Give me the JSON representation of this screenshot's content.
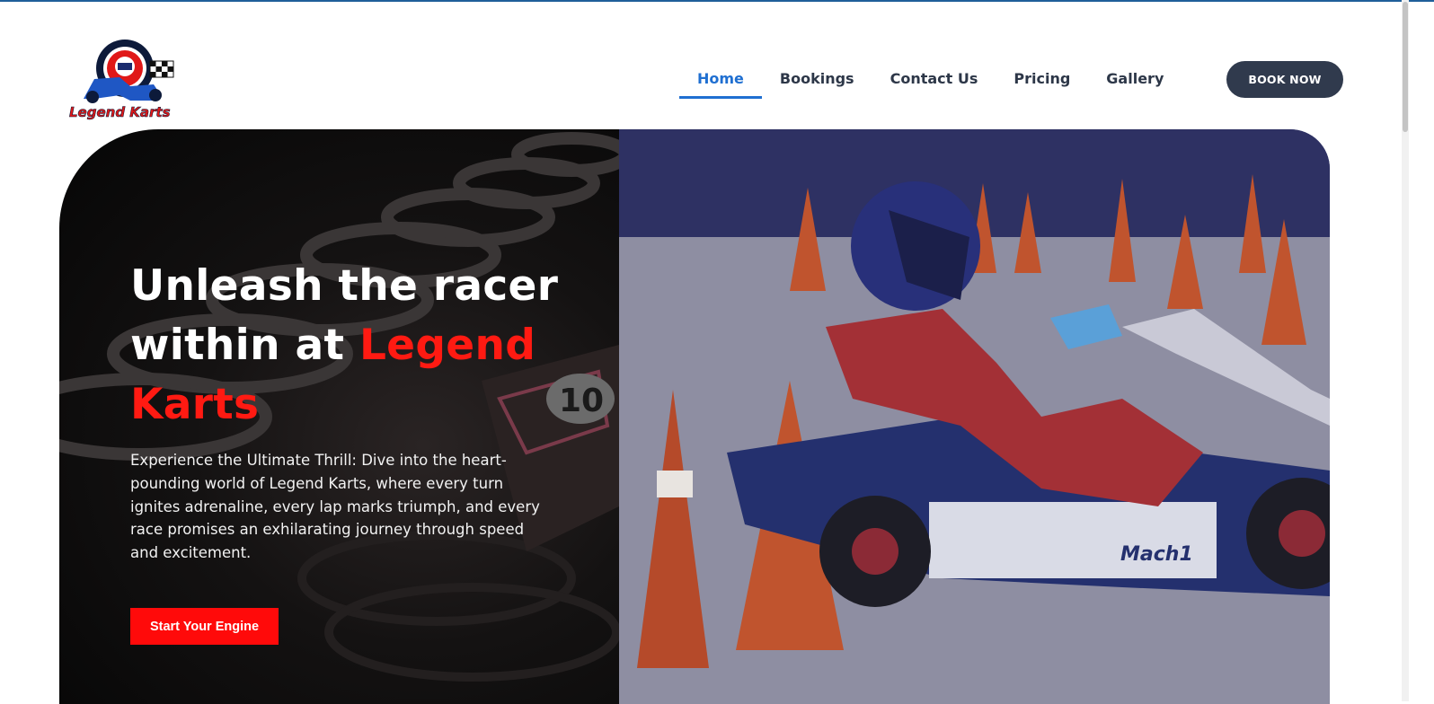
{
  "header": {
    "logo_text": "Legend Karts",
    "nav": [
      {
        "label": "Home",
        "active": true
      },
      {
        "label": "Bookings",
        "active": false
      },
      {
        "label": "Contact Us",
        "active": false
      },
      {
        "label": "Pricing",
        "active": false
      },
      {
        "label": "Gallery",
        "active": false
      }
    ],
    "book_button": "BOOK NOW"
  },
  "hero": {
    "headline_white": "Unleash the racer within at ",
    "headline_red": "Legend Karts",
    "description": "Experience the Ultimate Thrill: Dive into the heart-pounding world of Legend Karts, where every turn ignites adrenaline, every lap marks triumph, and every race promises an exhilarating journey through speed and excitement.",
    "cta_label": "Start Your Engine",
    "kart_number": "10",
    "photo_brand": "Mach1"
  },
  "colors": {
    "accent_blue": "#1f6fd1",
    "button_dark": "#303a4d",
    "brand_red": "#ff0a0a"
  }
}
